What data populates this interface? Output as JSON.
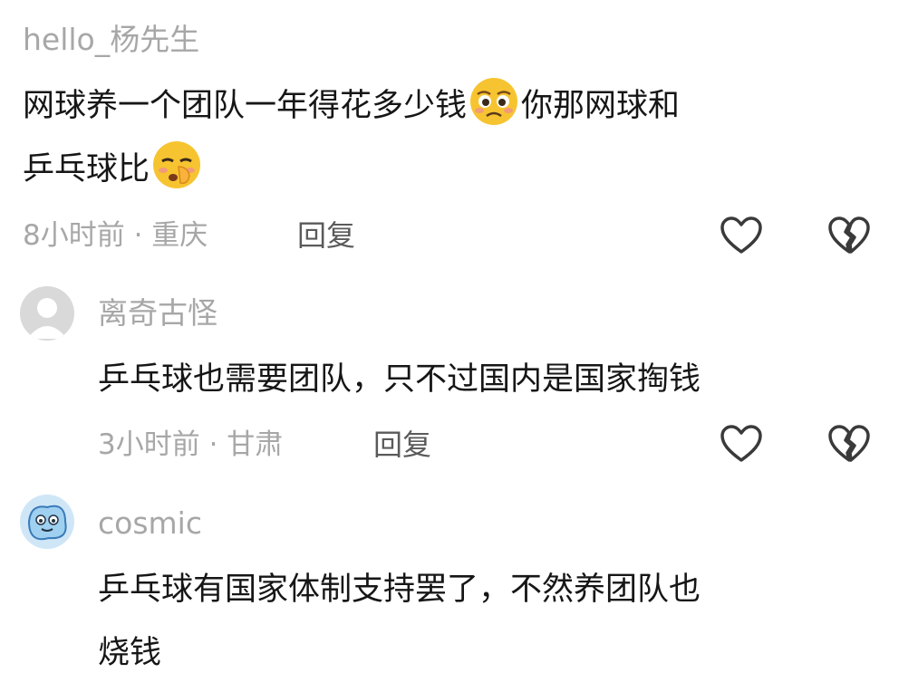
{
  "comments": [
    {
      "username": "hello_杨先生",
      "line1_a": "网球养一个团队一年得花多少钱",
      "emoji1": "pleading-face-icon",
      "line1_b": "你那网球和",
      "line2": "乒乓球比",
      "emoji2": "shushing-face-icon",
      "time_location": "8小时前 · 重庆",
      "reply_label": "回复"
    },
    {
      "username": "离奇古怪",
      "avatar": "default-avatar-icon",
      "text": "乒乓球也需要团队，只不过国内是国家掏钱",
      "time_location": "3小时前 · 甘肃",
      "reply_label": "回复"
    },
    {
      "username": "cosmic",
      "avatar": "cartoon-avatar-icon",
      "line1": "乒乓球有国家体制支持罢了，不然养团队也",
      "line2": "烧钱"
    }
  ],
  "icons": [
    "heart-outline-icon",
    "broken-heart-icon"
  ],
  "colors": {
    "secondary_text": "#a7a7a7",
    "primary_text": "#161616",
    "reply": "#5a5a5a",
    "emoji": "#f7c431"
  }
}
